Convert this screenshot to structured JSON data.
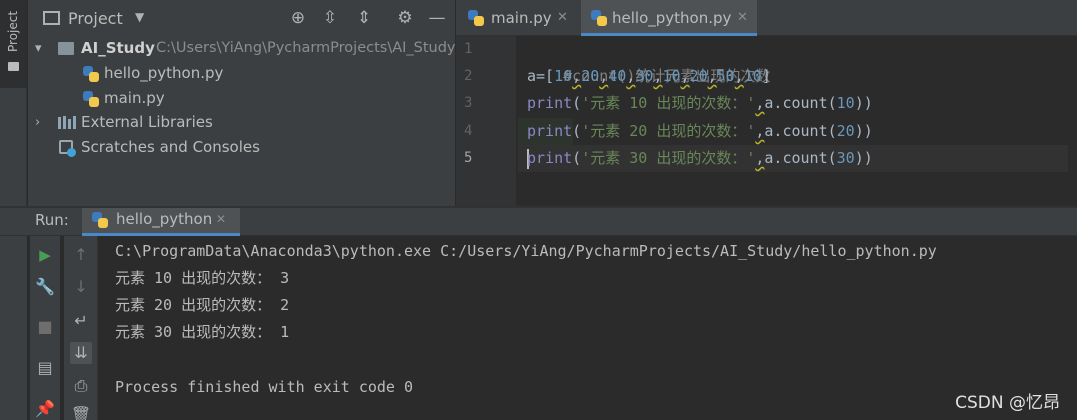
{
  "left_strip": {
    "project_tab_label": "Project"
  },
  "project_panel": {
    "title": "Project",
    "tree": {
      "root_name": "AI_Study",
      "root_path": "C:\\Users\\YiAng\\PycharmProjects\\AI_Study",
      "files": [
        "hello_python.py",
        "main.py"
      ],
      "external_libraries": "External Libraries",
      "scratches": "Scratches and Consoles"
    }
  },
  "editor": {
    "tabs": [
      {
        "label": "main.py",
        "active": false
      },
      {
        "label": "hello_python.py",
        "active": true
      }
    ],
    "line_numbers": [
      "1",
      "2",
      "3",
      "4",
      "5"
    ],
    "code": {
      "l1_comment": "#count()统计元素出现的次数",
      "l2_prefix": "a=[",
      "l2_values": [
        "10",
        "20",
        "40",
        "30",
        "10",
        "20",
        "50",
        "10"
      ],
      "l2_suffix": "]",
      "print_kw": "print",
      "open_paren": "(",
      "l3_str": "'元素 10 出现的次数：'",
      "l4_str": "'元素 20 出现的次数：'",
      "l5_str": "'元素 30 出现的次数：'",
      "comma": ",",
      "call_prefix": "a.count(",
      "l3_arg": "10",
      "l4_arg": "20",
      "l5_arg": "30",
      "close": "))"
    }
  },
  "run_panel": {
    "label": "Run:",
    "tab_label": "hello_python",
    "output": [
      "C:\\ProgramData\\Anaconda3\\python.exe C:/Users/YiAng/PycharmProjects/AI_Study/hello_python.py",
      "元素 10 出现的次数： 3",
      "元素 20 出现的次数： 2",
      "元素 30 出现的次数： 1",
      "",
      "Process finished with exit code 0"
    ]
  },
  "watermark": "CSDN @忆昂",
  "colors": {
    "accent": "#4a88c7",
    "run_green": "#499c54",
    "bg": "#2b2b2b",
    "panel": "#3c3f41"
  }
}
